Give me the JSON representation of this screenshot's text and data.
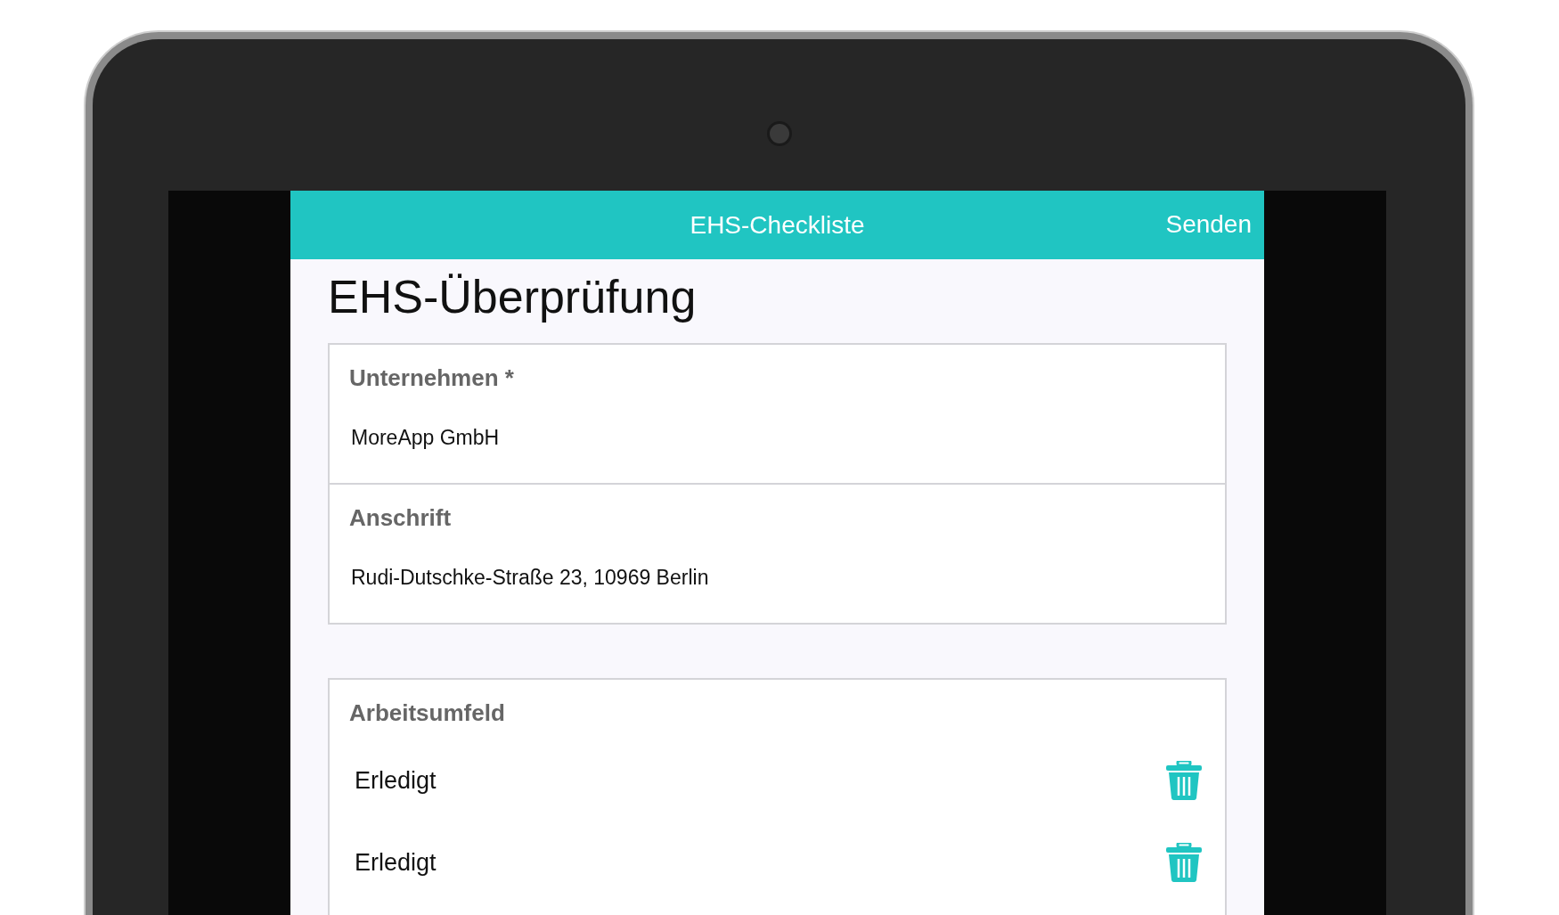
{
  "header": {
    "title": "EHS-Checkliste",
    "action": "Senden"
  },
  "page_title": "EHS-Überprüfung",
  "fields": [
    {
      "label": "Unternehmen *",
      "value": "MoreApp GmbH"
    },
    {
      "label": "Anschrift",
      "value": "Rudi-Dutschke-Straße 23, 10969 Berlin"
    }
  ],
  "list_section": {
    "label": "Arbeitsumfeld",
    "items": [
      {
        "text": "Erledigt"
      },
      {
        "text": "Erledigt"
      }
    ]
  }
}
